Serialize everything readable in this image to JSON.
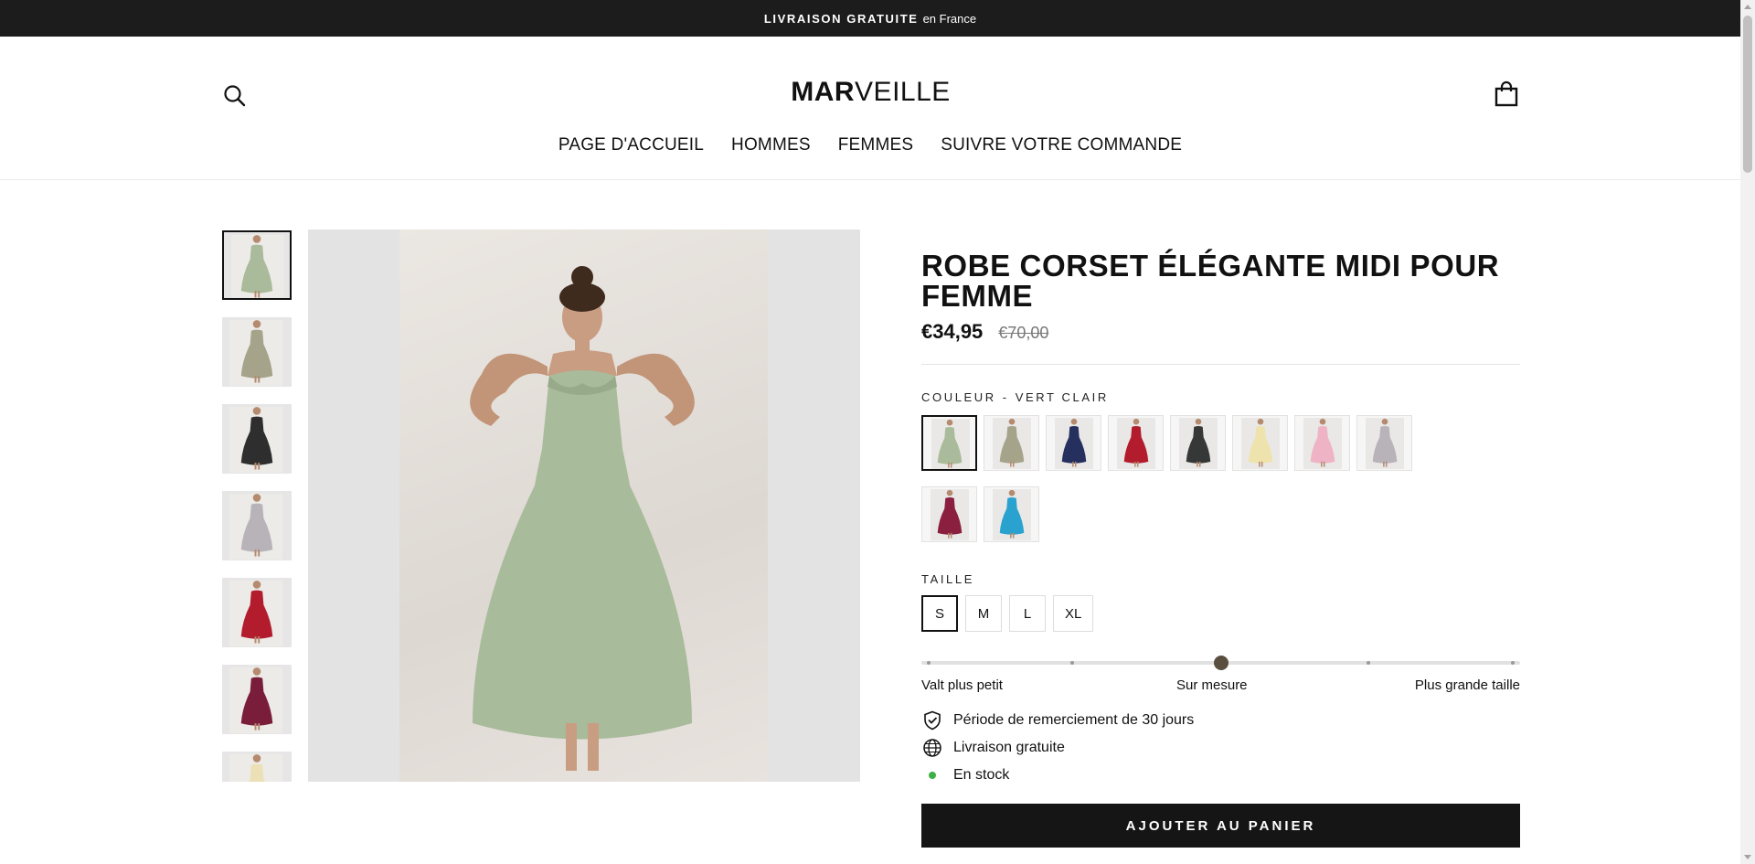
{
  "announcement": {
    "bold": "LIVRAISON GRATUITE",
    "rest": "en France"
  },
  "header": {
    "logo_bold": "MAR",
    "logo_light": "VEILLE",
    "nav": [
      "PAGE D'ACCUEIL",
      "HOMMES",
      "FEMMES",
      "SUIVRE VOTRE COMMANDE"
    ]
  },
  "gallery": {
    "thumbnails": [
      {
        "color": "#a9bb9a",
        "active": true
      },
      {
        "color": "#a5a38a",
        "active": false
      },
      {
        "color": "#2e2e2e",
        "active": false
      },
      {
        "color": "#b7b3b9",
        "active": false
      },
      {
        "color": "#b21c2c",
        "active": false
      },
      {
        "color": "#7a1d3a",
        "active": false
      },
      {
        "color": "#ece0b6",
        "active": false
      }
    ],
    "main_color": "#a8bb9b"
  },
  "product": {
    "title": "ROBE CORSET ÉLÉGANTE MIDI POUR FEMME",
    "price": "€34,95",
    "compare_price": "€70,00",
    "color_label": "COULEUR",
    "color_separator": "-",
    "color_value": "VERT CLAIR",
    "swatches": [
      {
        "color": "#a9bb9a",
        "active": true
      },
      {
        "color": "#a5a38a",
        "active": false
      },
      {
        "color": "#25305f",
        "active": false
      },
      {
        "color": "#b21c2c",
        "active": false
      },
      {
        "color": "#363838",
        "active": false
      },
      {
        "color": "#efe3ad",
        "active": false
      },
      {
        "color": "#eeb3c4",
        "active": false
      },
      {
        "color": "#b7b3b9",
        "active": false
      },
      {
        "color": "#8a1f40",
        "active": false
      },
      {
        "color": "#2aa2cf",
        "active": false
      }
    ],
    "size_label": "TAILLE",
    "sizes": [
      {
        "label": "S",
        "active": true
      },
      {
        "label": "M",
        "active": false
      },
      {
        "label": "L",
        "active": false
      },
      {
        "label": "XL",
        "active": false
      }
    ],
    "fit": {
      "left": "Valt plus petit",
      "center": "Sur mesure",
      "right": "Plus grande taille",
      "value": 0.5
    },
    "features": [
      {
        "icon": "shield-check-icon",
        "text": "Période de remerciement de 30 jours"
      },
      {
        "icon": "globe-icon",
        "text": "Livraison gratuite"
      },
      {
        "icon": "in-stock-dot-icon",
        "text": "En stock"
      }
    ],
    "add_to_cart": "AJOUTER AU PANIER"
  }
}
